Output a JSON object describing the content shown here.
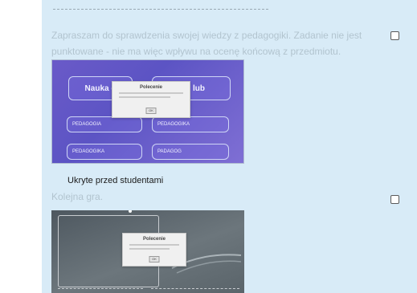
{
  "activity1": {
    "description": "Zapraszam do sprawdzenia swojej wiedzy z pedagogiki. Zadanie nie jest punktowane - nie ma więc wpływu na ocenę końcową z przedmiotu.",
    "thumbnail": {
      "box_main": "Nauka o",
      "box_main_right": "zej, lub",
      "box_main_sub": "k",
      "tiles": [
        "PEDAGOGIA",
        "PEDAGOGIKA",
        "PEDAGOGIKA",
        "PADAGOG"
      ],
      "popup_title": "Polecenie",
      "popup_ok": "OK"
    },
    "hidden_label": "Ukryte przed studentami"
  },
  "activity2": {
    "title": "Kolejna gra.",
    "thumbnail": {
      "popup_title": "Polecenie",
      "popup_ok": "OK"
    }
  },
  "colors": {
    "panel_bg": "#d8ebf7",
    "muted_text": "#b2c4cf"
  }
}
